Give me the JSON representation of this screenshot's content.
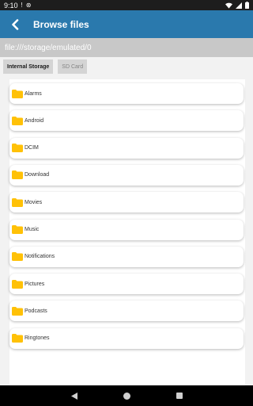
{
  "status_bar": {
    "time": "9:10",
    "left_icons": [
      "alert-icon",
      "sync-icon"
    ],
    "right_icons": [
      "wifi-icon",
      "signal-icon",
      "battery-icon"
    ]
  },
  "app_bar": {
    "title": "Browse files",
    "back_icon": "chevron-left-icon"
  },
  "path": "file:///storage/emulated/0",
  "storage_tabs": [
    {
      "label": "Internal Storage",
      "active": true
    },
    {
      "label": "SD Card",
      "active": false
    }
  ],
  "folders": [
    "Alarms",
    "Android",
    "DCIM",
    "Download",
    "Movies",
    "Music",
    "Notifications",
    "Pictures",
    "Podcasts",
    "Ringtones"
  ],
  "nav_bar": {
    "icons": [
      "back-triangle-icon",
      "home-circle-icon",
      "recents-square-icon"
    ]
  },
  "colors": {
    "app_bar": "#2a79ad",
    "path_bar": "#c8c8c8",
    "folder": "#ffc107",
    "status_bar": "#1d1d1d"
  }
}
